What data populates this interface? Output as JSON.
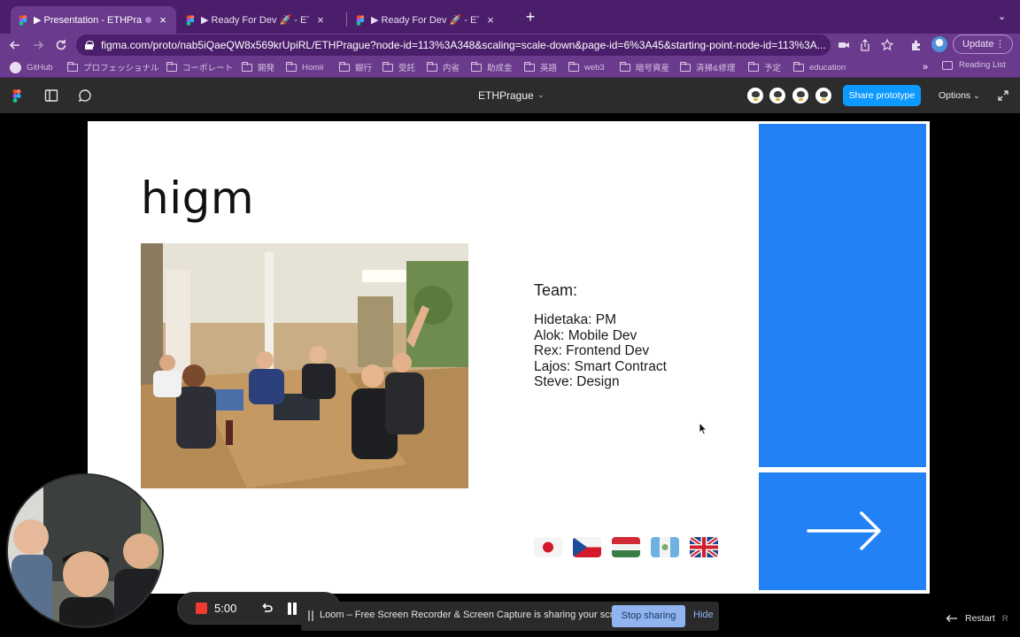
{
  "browser": {
    "tabs": [
      {
        "title": "▶ Presentation - ETHPrague",
        "active": true
      },
      {
        "title": "▶ Ready For Dev 🚀 - ETHPrague"
      },
      {
        "title": "▶ Ready For Dev 🚀 - ETHPrague"
      }
    ],
    "tab_close": "×",
    "new_tab": "+",
    "tab_menu": "⌄",
    "url": "figma.com/proto/nab5iQaeQW8x569krUpiRL/ETHPrague?node-id=113%3A348&scaling=scale-down&page-id=6%3A45&starting-point-node-id=113%3A...",
    "update_label": "Update",
    "bookmarks": [
      "GitHub",
      "プロフェッショナル",
      "コーポレート",
      "開発",
      "Homii",
      "銀行",
      "受託",
      "内省",
      "助成金",
      "英語",
      "web3",
      "暗号資産",
      "清掃&修理",
      "予定",
      "education"
    ],
    "bookmarks_more": "»",
    "reading_list": "Reading List"
  },
  "figma": {
    "document_title": "ETHPrague",
    "share_label": "Share prototype",
    "options_label": "Options",
    "avatar_count": 4
  },
  "slide": {
    "title": "higm",
    "team_heading": "Team:",
    "team_members": [
      "Hidetaka: PM",
      "Alok: Mobile Dev",
      "Rex: Frontend Dev",
      "Lajos: Smart Contract",
      "Steve: Design"
    ],
    "flags": [
      "japan-flag",
      "czech-flag",
      "hungary-flag",
      "guatemala-flag",
      "uk-flag"
    ],
    "colors": {
      "panel": "#2282f5",
      "background": "#ffffff"
    }
  },
  "loom": {
    "timer": "5:00",
    "sharing_text": "Loom – Free Screen Recorder & Screen Capture is sharing your screen.",
    "stop_label": "Stop sharing",
    "hide_label": "Hide",
    "record_color": "#ef3a2f"
  },
  "prototype": {
    "restart_label": "Restart",
    "restart_key": "R"
  }
}
